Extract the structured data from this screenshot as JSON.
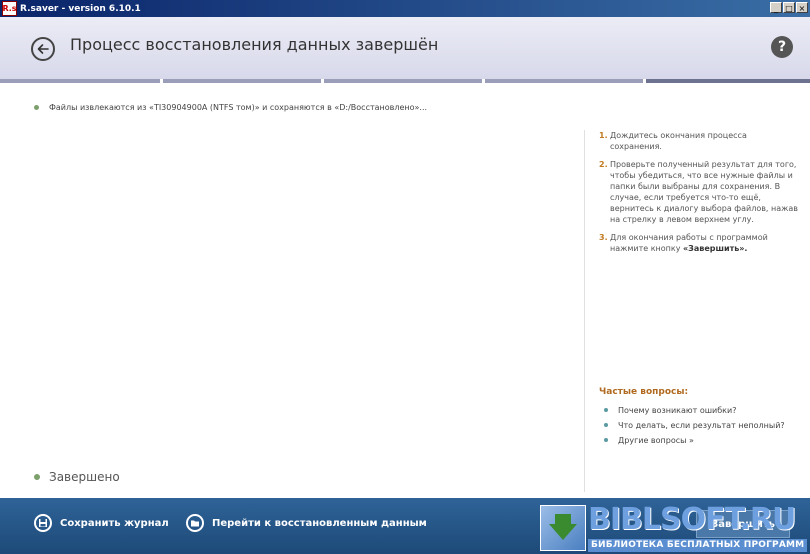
{
  "window": {
    "icon_text": "R.s",
    "title": "R.saver - version 6.10.1",
    "minimize": "_",
    "maximize": "□",
    "close": "×"
  },
  "header": {
    "title": "Процесс восстановления данных завершён",
    "back_icon": "arrow-left-icon",
    "help_icon": "?"
  },
  "main": {
    "status": "Файлы извлекаются из «TI30904900A (NTFS том)» и сохраняются в «D:/Восстановлено»...",
    "done": "Завершено"
  },
  "instructions": [
    {
      "num": "1.",
      "text": "Дождитесь окончания процесса сохранения."
    },
    {
      "num": "2.",
      "text": "Проверьте полученный результат для того, чтобы убедиться, что все нужные файлы и папки были выбраны для сохранения. В случае, если требуется что-то ещё, вернитесь к диалогу выбора файлов, нажав на стрелку в левом верхнем углу."
    },
    {
      "num": "3.",
      "text": "Для окончания работы с программой нажмите кнопку",
      "bold": "«Завершить»."
    }
  ],
  "faq": {
    "title": "Частые вопросы:",
    "items": [
      "Почему возникают ошибки?",
      "Что делать, если результат неполный?",
      "Другие вопросы »"
    ]
  },
  "footer": {
    "save_log": "Сохранить журнал",
    "go_to_data": "Перейти к восстановленным данным",
    "finish": "Завершить"
  },
  "watermark": {
    "name": "BIBLSOFT.RU",
    "subtitle": "БИБЛИОТЕКА БЕСПЛАТНЫХ ПРОГРАММ"
  }
}
